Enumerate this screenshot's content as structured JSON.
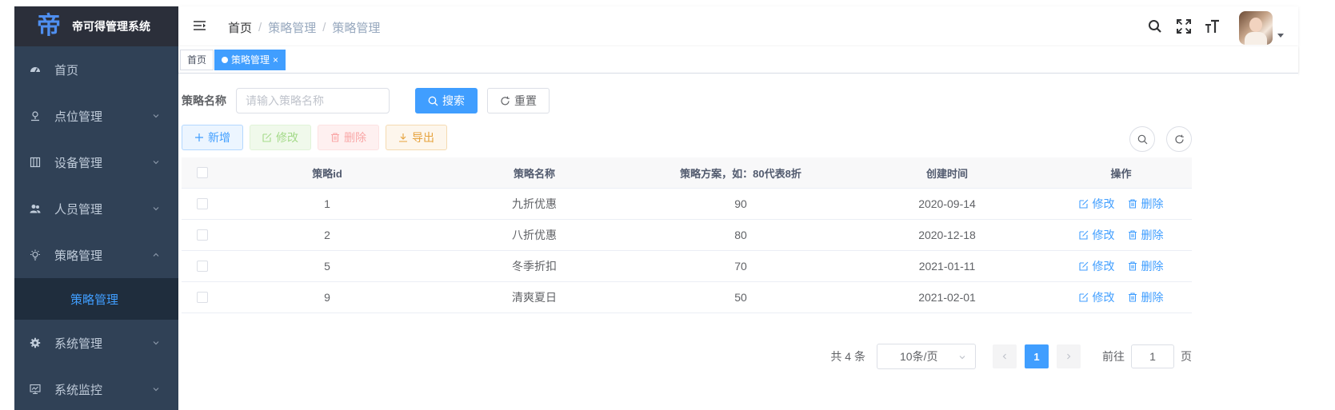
{
  "app": {
    "title": "帝可得管理系统",
    "logo_glyph": "帝"
  },
  "sidebar": {
    "items": [
      {
        "label": "首页",
        "icon": "dashboard-icon",
        "expandable": false
      },
      {
        "label": "点位管理",
        "icon": "location-icon",
        "expandable": true
      },
      {
        "label": "设备管理",
        "icon": "device-icon",
        "expandable": true
      },
      {
        "label": "人员管理",
        "icon": "people-icon",
        "expandable": true
      },
      {
        "label": "策略管理",
        "icon": "lightbulb-icon",
        "expandable": true,
        "expanded": true
      },
      {
        "label": "系统管理",
        "icon": "gear-icon",
        "expandable": true
      },
      {
        "label": "系统监控",
        "icon": "monitor-icon",
        "expandable": true
      }
    ],
    "submenu_active": "策略管理"
  },
  "header": {
    "breadcrumb": [
      "首页",
      "策略管理",
      "策略管理"
    ],
    "breadcrumb_sep": "/"
  },
  "tags": [
    {
      "label": "首页",
      "active": false
    },
    {
      "label": "策略管理",
      "active": true,
      "close": "×"
    }
  ],
  "search": {
    "label": "策略名称",
    "placeholder": "请输入策略名称",
    "search_label": "搜索",
    "reset_label": "重置"
  },
  "toolbar": {
    "add_label": "新增",
    "edit_label": "修改",
    "delete_label": "删除",
    "export_label": "导出"
  },
  "table": {
    "columns": [
      "策略id",
      "策略名称",
      "策略方案，如：80代表8折",
      "创建时间",
      "操作"
    ],
    "rows": [
      {
        "id": "1",
        "name": "九折优惠",
        "plan": "90",
        "time": "2020-09-14"
      },
      {
        "id": "2",
        "name": "八折优惠",
        "plan": "80",
        "time": "2020-12-18"
      },
      {
        "id": "5",
        "name": "冬季折扣",
        "plan": "70",
        "time": "2021-01-11"
      },
      {
        "id": "9",
        "name": "清爽夏日",
        "plan": "50",
        "time": "2021-02-01"
      }
    ],
    "row_edit": "修改",
    "row_delete": "删除"
  },
  "pagination": {
    "total": "共 4 条",
    "page_size": "10条/页",
    "current_page": "1",
    "goto_label": "前往",
    "goto_value": "1",
    "page_suffix": "页"
  },
  "colors": {
    "primary": "#409eff",
    "sidebar_bg": "#304156",
    "submenu_bg": "#1f2d3d"
  }
}
